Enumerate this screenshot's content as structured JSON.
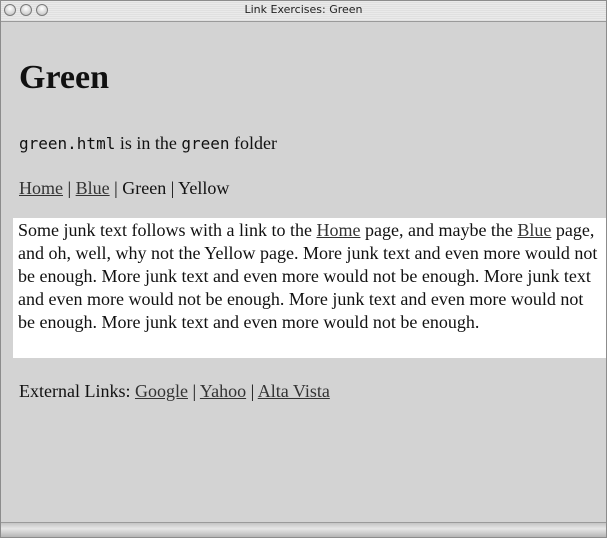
{
  "window": {
    "title": "Link Exercises: Green"
  },
  "page": {
    "heading": "Green",
    "file_note": {
      "filename": "green.html",
      "mid_text": " is in the ",
      "folder": "green",
      "end_text": " folder"
    },
    "nav": {
      "home": "Home",
      "sep1": " | ",
      "blue": "Blue",
      "sep2": " | ",
      "green": "Green",
      "sep3": " | ",
      "yellow": "Yellow"
    },
    "junk": {
      "part1": "Some junk text follows with a link to the ",
      "home_link": "Home",
      "part2": " page, and maybe the ",
      "blue_link": "Blue",
      "part3": " page, and oh, well, why not the Yellow page. More junk text and even more would not be enough. More junk text and even more would not be enough. More junk text and even more would not be enough. More junk text and even more would not be enough. More junk text and even more would not be enough."
    },
    "external": {
      "label": "External Links: ",
      "google": "Google",
      "sep1": " | ",
      "yahoo": "Yahoo",
      "sep2": " | ",
      "altavista": "Alta Vista"
    }
  },
  "colors": {
    "page_background": "#d3d3d3",
    "highlight_background": "#ffffff",
    "link": "#333333"
  }
}
